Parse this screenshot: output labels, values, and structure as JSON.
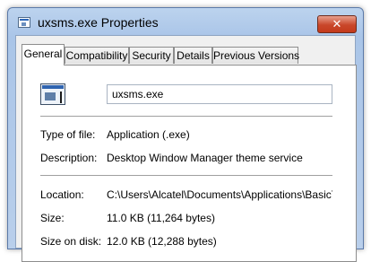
{
  "window": {
    "title": "uxsms.exe Properties",
    "close_glyph": "✕"
  },
  "tabs": [
    {
      "label": "General",
      "active": true
    },
    {
      "label": "Compatibility",
      "active": false
    },
    {
      "label": "Security",
      "active": false
    },
    {
      "label": "Details",
      "active": false
    },
    {
      "label": "Previous Versions",
      "active": false
    }
  ],
  "general": {
    "file_icon": "application-icon",
    "filename_value": "uxsms.exe",
    "type_label": "Type of file:",
    "type_value": "Application (.exe)",
    "description_label": "Description:",
    "description_value": "Desktop Window Manager theme service",
    "location_label": "Location:",
    "location_value": "C:\\Users\\Alcatel\\Documents\\Applications\\BasicThe",
    "size_label": "Size:",
    "size_value": "11.0 KB (11,264 bytes)",
    "size_on_disk_label": "Size on disk:",
    "size_on_disk_value": "12.0 KB (12,288 bytes)"
  }
}
